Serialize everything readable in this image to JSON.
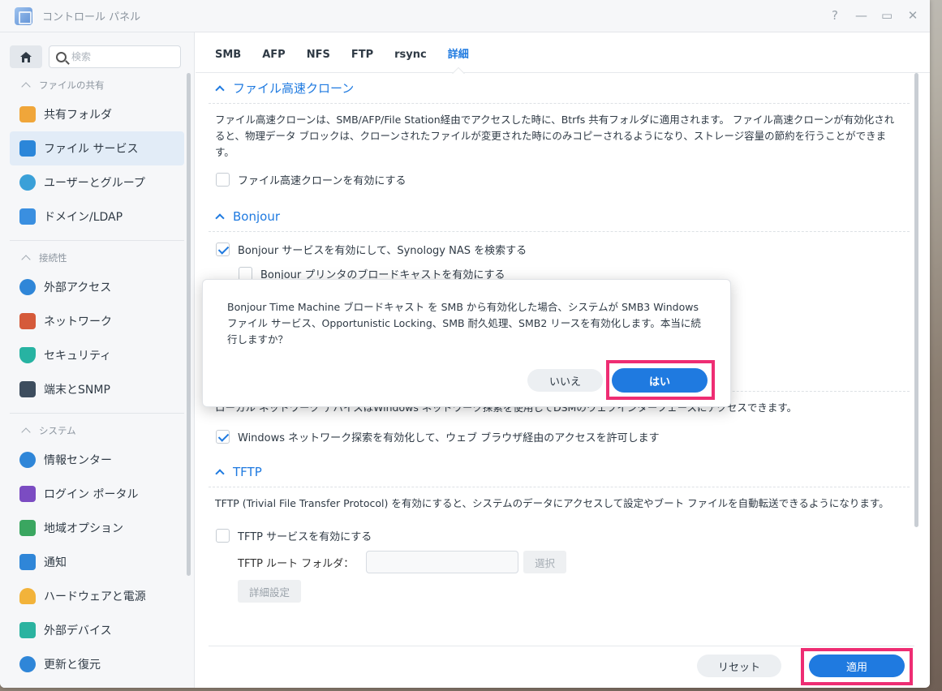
{
  "window": {
    "title": "コントロール パネル",
    "controls": [
      "?",
      "—",
      "▭",
      "✕"
    ]
  },
  "sidebar": {
    "search_placeholder": "検索",
    "sections": [
      {
        "label": "ファイルの共有",
        "items": [
          {
            "label": "共有フォルダ",
            "icon": "folder-share-icon",
            "color": "#f0a63a"
          },
          {
            "label": "ファイル サービス",
            "icon": "file-services-icon",
            "color": "#2b86d9",
            "active": true
          },
          {
            "label": "ユーザーとグループ",
            "icon": "users-icon",
            "color": "#3aa0d8"
          },
          {
            "label": "ドメイン/LDAP",
            "icon": "domain-icon",
            "color": "#3a8fe0"
          }
        ]
      },
      {
        "label": "接続性",
        "items": [
          {
            "label": "外部アクセス",
            "icon": "external-access-icon",
            "color": "#2f86d8"
          },
          {
            "label": "ネットワーク",
            "icon": "network-house-icon",
            "color": "#d55a3a"
          },
          {
            "label": "セキュリティ",
            "icon": "shield-icon",
            "color": "#27b3a2"
          },
          {
            "label": "端末とSNMP",
            "icon": "terminal-icon",
            "color": "#3d4d5e"
          }
        ]
      },
      {
        "label": "システム",
        "items": [
          {
            "label": "情報センター",
            "icon": "info-icon",
            "color": "#2f86d8"
          },
          {
            "label": "ログイン ポータル",
            "icon": "login-portal-icon",
            "color": "#7b4cc2"
          },
          {
            "label": "地域オプション",
            "icon": "regional-map-icon",
            "color": "#3aa660"
          },
          {
            "label": "通知",
            "icon": "notification-icon",
            "color": "#2f86d8"
          },
          {
            "label": "ハードウェアと電源",
            "icon": "lightbulb-icon",
            "color": "#f2b33a"
          },
          {
            "label": "外部デバイス",
            "icon": "external-device-icon",
            "color": "#2bb3a0"
          },
          {
            "label": "更新と復元",
            "icon": "update-restore-icon",
            "color": "#2f86d8"
          }
        ]
      }
    ]
  },
  "tabs": [
    "SMB",
    "AFP",
    "NFS",
    "FTP",
    "rsync",
    "詳細"
  ],
  "active_tab": "詳細",
  "sections": {
    "fast_clone": {
      "title": "ファイル高速クローン",
      "description": "ファイル高速クローンは、SMB/AFP/File Station経由でアクセスした時に、Btrfs 共有フォルダに適用されます。 ファイル高速クローンが有効化されると、物理データ ブロックは、クローンされたファイルが変更された時にのみコピーされるようになり、ストレージ容量の節約を行うことができます。",
      "checkbox": "ファイル高速クローンを有効にする"
    },
    "bonjour": {
      "title": "Bonjour",
      "checkbox_main": "Bonjour サービスを有効にして、Synology NAS を検索する",
      "checkbox_printer": "Bonjour プリンタのブロードキャストを有効にする"
    },
    "wsd": {
      "description": "ローカル ネットワーク デバイスはWindows ネットワーク探索を使用してDSMのウェブインターフェースにアクセスできます。",
      "checkbox": "Windows ネットワーク探索を有効化して、ウェブ ブラウザ経由のアクセスを許可します"
    },
    "tftp": {
      "title": "TFTP",
      "description": "TFTP (Trivial File Transfer Protocol) を有効にすると、システムのデータにアクセスして設定やブート ファイルを自動転送できるようになります。",
      "checkbox": "TFTP サービスを有効にする",
      "root_folder_label": "TFTP ルート フォルダ：",
      "root_folder_value": "",
      "select_button": "選択",
      "advanced_button": "詳細設定"
    }
  },
  "footer": {
    "reset": "リセット",
    "apply": "適用"
  },
  "dialog": {
    "message": "Bonjour Time Machine ブロードキャスト を SMB から有効化した場合、システムが SMB3 Windows ファイル サービス、Opportunistic Locking、SMB 耐久処理、SMB2 リースを有効化します。本当に続行しますか？",
    "no": "いいえ",
    "yes": "はい"
  },
  "colors": {
    "accent": "#1f7ae0",
    "highlight": "#ee2d73"
  }
}
